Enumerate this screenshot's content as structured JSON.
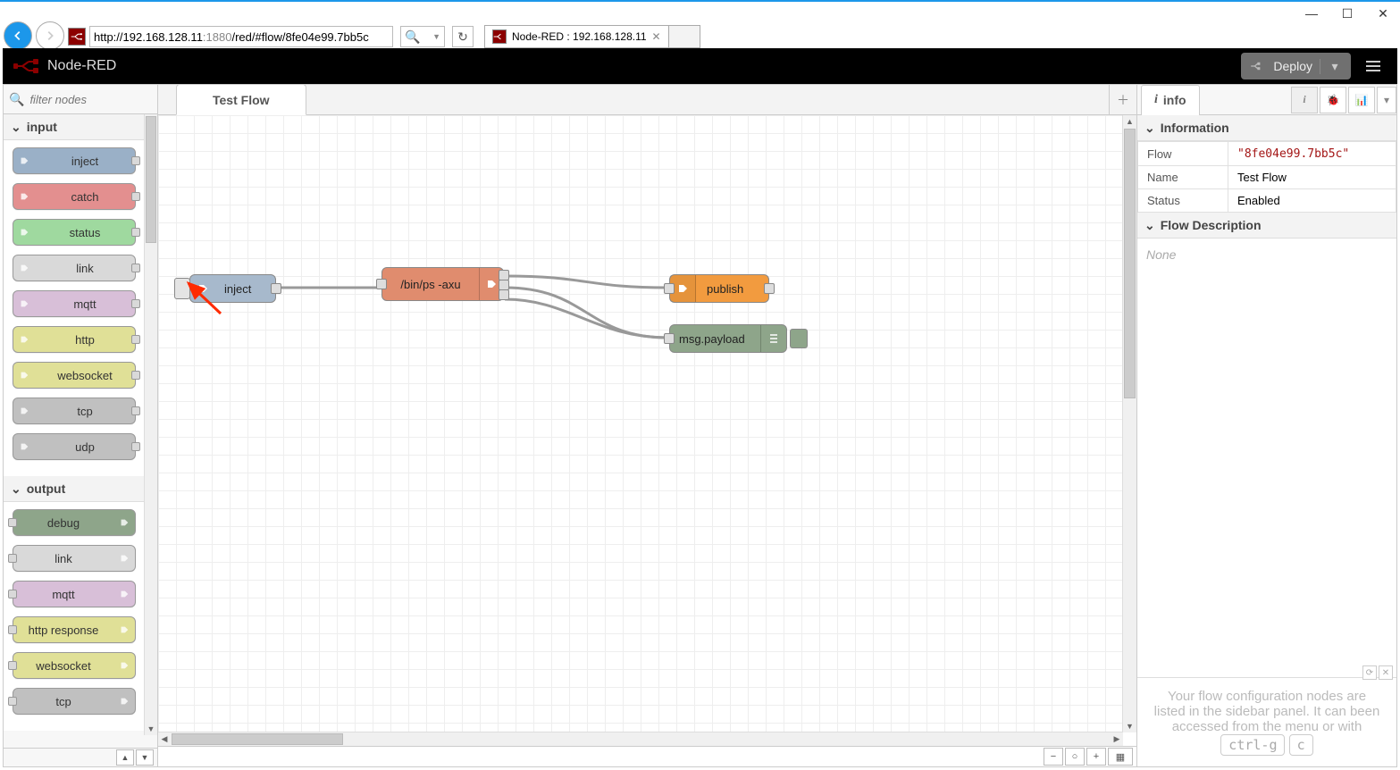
{
  "browser": {
    "url_prefix": "http://192.168.128.11",
    "url_port": ":1880",
    "url_path": "/red/#flow/8fe04e99.7bb5c",
    "tab_title": "Node-RED : 192.168.128.11"
  },
  "header": {
    "title": "Node-RED",
    "deploy_label": "Deploy"
  },
  "palette": {
    "search_placeholder": "filter nodes",
    "categories": [
      {
        "name": "input",
        "nodes": [
          {
            "label": "inject",
            "color": "inject",
            "port": "right"
          },
          {
            "label": "catch",
            "color": "catch",
            "port": "right"
          },
          {
            "label": "status",
            "color": "status",
            "port": "right"
          },
          {
            "label": "link",
            "color": "link",
            "port": "right"
          },
          {
            "label": "mqtt",
            "color": "mqtt",
            "port": "right"
          },
          {
            "label": "http",
            "color": "http",
            "port": "right"
          },
          {
            "label": "websocket",
            "color": "ws",
            "port": "right"
          },
          {
            "label": "tcp",
            "color": "tcp",
            "port": "right"
          },
          {
            "label": "udp",
            "color": "udp",
            "port": "right"
          }
        ]
      },
      {
        "name": "output",
        "nodes": [
          {
            "label": "debug",
            "color": "debug",
            "port": "left",
            "iconside": "right"
          },
          {
            "label": "link",
            "color": "linkout",
            "port": "left",
            "iconside": "right"
          },
          {
            "label": "mqtt",
            "color": "mqttout",
            "port": "left",
            "iconside": "right"
          },
          {
            "label": "http response",
            "color": "httpresp",
            "port": "left",
            "iconside": "right"
          },
          {
            "label": "websocket",
            "color": "ws",
            "port": "left",
            "iconside": "right"
          },
          {
            "label": "tcp",
            "color": "tcp",
            "port": "left",
            "iconside": "right"
          }
        ]
      }
    ]
  },
  "workspace": {
    "tab_label": "Test Flow",
    "nodes": {
      "inject": "inject",
      "exec": "/bin/ps -axu",
      "publish": "publish",
      "debug": "msg.payload"
    }
  },
  "sidebar": {
    "tab": "info",
    "sections": {
      "information": "Information",
      "description": "Flow Description"
    },
    "info": {
      "flow_label": "Flow",
      "flow_id": "\"8fe04e99.7bb5c\"",
      "name_label": "Name",
      "name_value": "Test Flow",
      "status_label": "Status",
      "status_value": "Enabled"
    },
    "desc_none": "None",
    "hint": "Your flow configuration nodes are listed in the sidebar panel. It can been accessed from the menu or with",
    "hint_key1": "ctrl-g",
    "hint_key2": "c"
  }
}
